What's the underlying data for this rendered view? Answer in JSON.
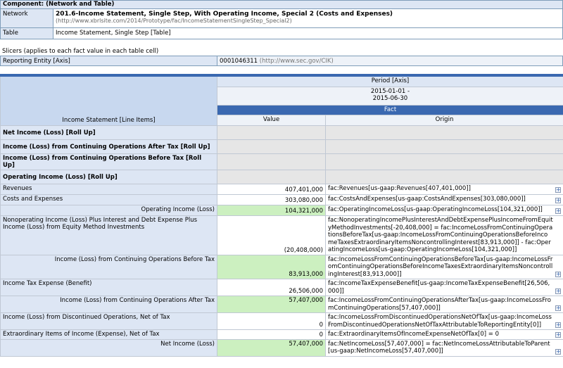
{
  "component": {
    "header": "Component: (Network and Table)",
    "network_label": "Network",
    "network_title": "201.6-Income Statement, Single Step, With Operating Income, Special 2 (Costs and Expenses)",
    "network_url": "(http://www.xbrlsite.com/2014/Prototype/fac/IncomeStatementSingleStep_Special2)",
    "table_label": "Table",
    "table_value": "Income Statement, Single Step [Table]"
  },
  "slicers": {
    "title": "Slicers (applies to each fact value in each table cell)",
    "axis": "Reporting Entity [Axis]",
    "value": "0001046311",
    "url": "(http://www.sec.gov/CIK)"
  },
  "table": {
    "line_items_header": "Income Statement [Line Items]",
    "period_axis": "Period [Axis]",
    "period_value": "2015-01-01 - 2015-06-30",
    "fact_header": "Fact",
    "value_header": "Value",
    "origin_header": "Origin",
    "expand_glyph": "+",
    "rollup_rows": [
      "Net Income (Loss) [Roll Up]",
      "Income (Loss) from Continuing Operations After Tax [Roll Up]",
      "Income (Loss) from Continuing Operations Before Tax [Roll Up]",
      "Operating Income (Loss) [Roll Up]"
    ],
    "rows": [
      {
        "label": "Revenues",
        "value": "407,401,000",
        "origin": "fac:Revenues[us-gaap:Revenues[407,401,000]]"
      },
      {
        "label": "Costs and Expenses",
        "value": "303,080,000",
        "origin": "fac:CostsAndExpenses[us-gaap:CostsAndExpenses[303,080,000]]"
      },
      {
        "label": "Operating Income (Loss)",
        "value": "104,321,000",
        "origin": "fac:OperatingIncomeLoss[us-gaap:OperatingIncomeLoss[104,321,000]]"
      },
      {
        "label": "Nonoperating Income (Loss) Plus Interest and Debt Expense Plus Income (Loss) from Equity Method Investments",
        "value": "(20,408,000)",
        "origin": "fac:NonoperatingIncomePlusInterestAndDebtExpensePlusIncomeFromEquityMethodInvestments[-20,408,000] = fac:IncomeLossFromContinuingOperationsBeforeTax[us-gaap:IncomeLossFromContinuingOperationsBeforeIncomeTaxesExtraordinaryItemsNoncontrollingInterest[83,913,000]] - fac:OperatingIncomeLoss[us-gaap:OperatingIncomeLoss[104,321,000]]"
      },
      {
        "label": "Income (Loss) from Continuing Operations Before Tax",
        "value": "83,913,000",
        "origin": "fac:IncomeLossFromContinuingOperationsBeforeTax[us-gaap:IncomeLossFromContinuingOperationsBeforeIncomeTaxesExtraordinaryItemsNoncontrollingInterest[83,913,000]]"
      },
      {
        "label": "Income Tax Expense (Benefit)",
        "value": "26,506,000",
        "origin": "fac:IncomeTaxExpenseBenefit[us-gaap:IncomeTaxExpenseBenefit[26,506,000]]"
      },
      {
        "label": "Income (Loss) from Continuing Operations After Tax",
        "value": "57,407,000",
        "origin": "fac:IncomeLossFromContinuingOperationsAfterTax[us-gaap:IncomeLossFromContinuingOperations[57,407,000]]"
      },
      {
        "label": "Income (Loss) from Discontinued Operations, Net of Tax",
        "value": "0",
        "origin": "fac:IncomeLossFromDiscontinuedOperationsNetOfTax[us-gaap:IncomeLossFromDiscontinuedOperationsNetOfTaxAttributableToReportingEntity[0]]"
      },
      {
        "label": "Extraordinary Items of Income (Expense), Net of Tax",
        "value": "0",
        "origin": "fac:ExtraordinaryItemsOfIncomeExpenseNetOfTax[0] = 0"
      },
      {
        "label": "Net Income (Loss)",
        "value": "57,407,000",
        "origin": "fac:NetIncomeLoss[57,407,000] = fac:NetIncomeLossAttributableToParent[us-gaap:NetIncomeLoss[57,407,000]]"
      }
    ]
  },
  "colors": {
    "header_blue": "#3a68b0",
    "label_bg": "#dde6f4",
    "highlight_green": "#ccf0c0",
    "rollup_grey": "#e6e6e6"
  }
}
